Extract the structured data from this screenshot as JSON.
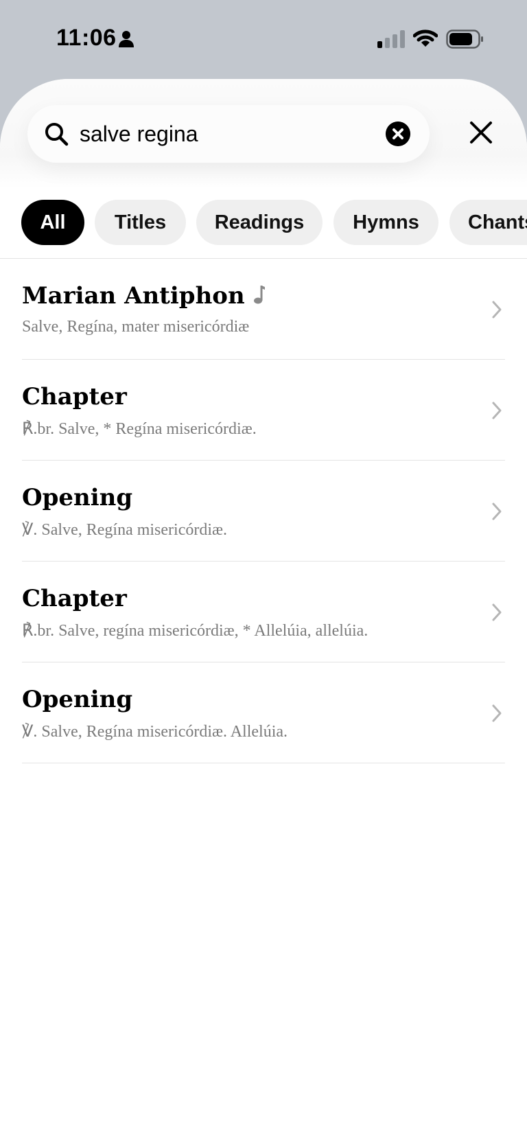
{
  "status_bar": {
    "time": "11:06",
    "icons": [
      "person-icon",
      "signal-icon",
      "wifi-icon",
      "battery-icon"
    ]
  },
  "search": {
    "value": "salve regina",
    "icon": "search-icon",
    "clear_icon": "clear-icon",
    "close_icon": "close-icon"
  },
  "filters": [
    {
      "label": "All",
      "active": true
    },
    {
      "label": "Titles",
      "active": false
    },
    {
      "label": "Readings",
      "active": false
    },
    {
      "label": "Hymns",
      "active": false
    },
    {
      "label": "Chants",
      "active": false
    }
  ],
  "results": [
    {
      "title": "Marian Antiphon",
      "snippet": "Salve, Regína, mater misericórdiæ",
      "icon": "music-note-icon"
    },
    {
      "title": "Chapter",
      "snippet": "℟.br. Salve, * Regína misericórdiæ."
    },
    {
      "title": "Opening",
      "snippet": "℣. Salve, Regína misericórdiæ."
    },
    {
      "title": "Chapter",
      "snippet": "℟.br. Salve, regína misericórdiæ, * Allelúia, allelúia."
    },
    {
      "title": "Opening",
      "snippet": "℣. Salve, Regína misericórdiæ. Allelúia."
    }
  ],
  "colors": {
    "status_background": "#c2c7ce",
    "sheet_background": "#ffffff",
    "chip_active": "#000000",
    "chip_inactive": "#efefef",
    "snippet_text": "#7a7a7a",
    "divider": "#e4e4e4"
  }
}
